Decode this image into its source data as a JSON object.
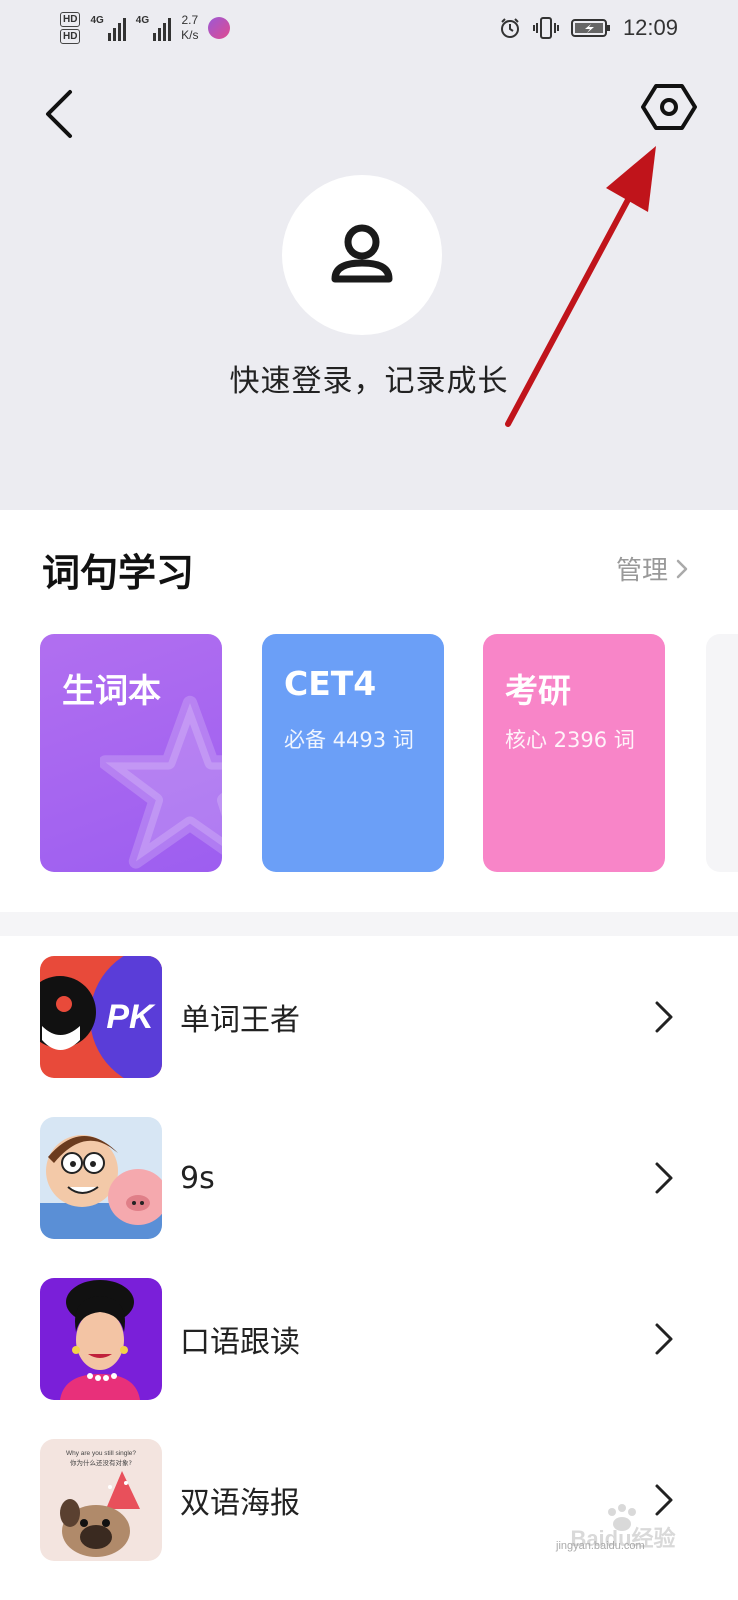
{
  "status_bar": {
    "hd1": "HD",
    "hd2": "HD",
    "net1": "4G",
    "net2": "4G",
    "speed_value": "2.7",
    "speed_unit": "K/s",
    "time": "12:09"
  },
  "header": {
    "login_text": "快速登录，记录成长"
  },
  "section": {
    "title": "词句学习",
    "manage_label": "管理"
  },
  "cards": [
    {
      "title": "生词本",
      "subtitle": "",
      "color": "#a66af2"
    },
    {
      "title": "CET4",
      "subtitle": "必备 4493 词",
      "color": "#6b9ff7"
    },
    {
      "title": "考研",
      "subtitle": "核心 2396 词",
      "color": "#f885c8"
    }
  ],
  "list": [
    {
      "label": "单词王者",
      "thumb_text": "PK"
    },
    {
      "label": "9s"
    },
    {
      "label": "口语跟读"
    },
    {
      "label": "双语海报",
      "thumb_line1": "Why are you still single?",
      "thumb_line2": "你为什么还没有对象?"
    }
  ],
  "watermark": {
    "brand": "Baidu经验",
    "domain": "jingyan.baidu.com"
  },
  "colors": {
    "header_bg": "#ececf1",
    "annotation_arrow": "#c0141b"
  }
}
